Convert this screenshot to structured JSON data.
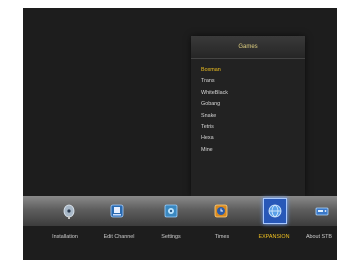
{
  "popup": {
    "title": "Games",
    "items": [
      "Boxman",
      "Trans",
      "WhiteBlack",
      "Gobang",
      "Snake",
      "Tetris",
      "Hexa",
      "Mine"
    ],
    "selected_item": "Boxman"
  },
  "menu": {
    "items": [
      {
        "label": "Installation",
        "icon": "satellite-dish-icon"
      },
      {
        "label": "Edit Channel",
        "icon": "edit-channel-icon"
      },
      {
        "label": "Settings",
        "icon": "settings-icon"
      },
      {
        "label": "Times",
        "icon": "clock-icon"
      },
      {
        "label": "EXPANSION",
        "icon": "expansion-globe-icon"
      },
      {
        "label": "About STB",
        "icon": "stb-box-icon"
      }
    ],
    "active_item": "EXPANSION"
  },
  "colors": {
    "selected_text": "#f0c020",
    "active_tab_bg": "#2858b8",
    "screen_bg": "#1d1d1d"
  }
}
